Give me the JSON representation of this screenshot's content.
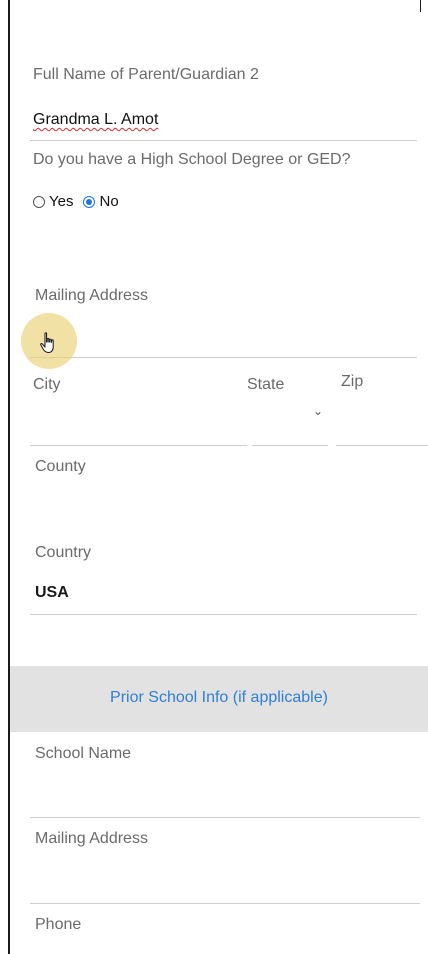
{
  "form": {
    "guardian2_name_label": "Full Name of Parent/Guardian 2",
    "guardian2_name_value": "Grandma L. Amot",
    "ged_question": "Do you have a High School Degree or GED?",
    "ged_options": [
      {
        "label": "Yes",
        "checked": false
      },
      {
        "label": "No",
        "checked": true
      }
    ],
    "mailing_address_label": "Mailing Address",
    "mailing_address_value": "",
    "city_label": "City",
    "state_label": "State",
    "zip_label": "Zip",
    "county_label": "County",
    "country_label": "Country",
    "country_value": "USA"
  },
  "prior_school": {
    "section_title": "Prior School Info (if applicable)",
    "school_name_label": "School Name",
    "mailing_address_label": "Mailing Address",
    "phone_label": "Phone"
  },
  "colors": {
    "accent": "#2f7fd4",
    "section_bg": "#e2e2e2",
    "radio_checked": "#1a73e8",
    "cursor_highlight": "#e8ce6e"
  },
  "icons": {
    "cursor": "hand-pointer-icon",
    "state_dropdown": "chevron-down-icon"
  }
}
